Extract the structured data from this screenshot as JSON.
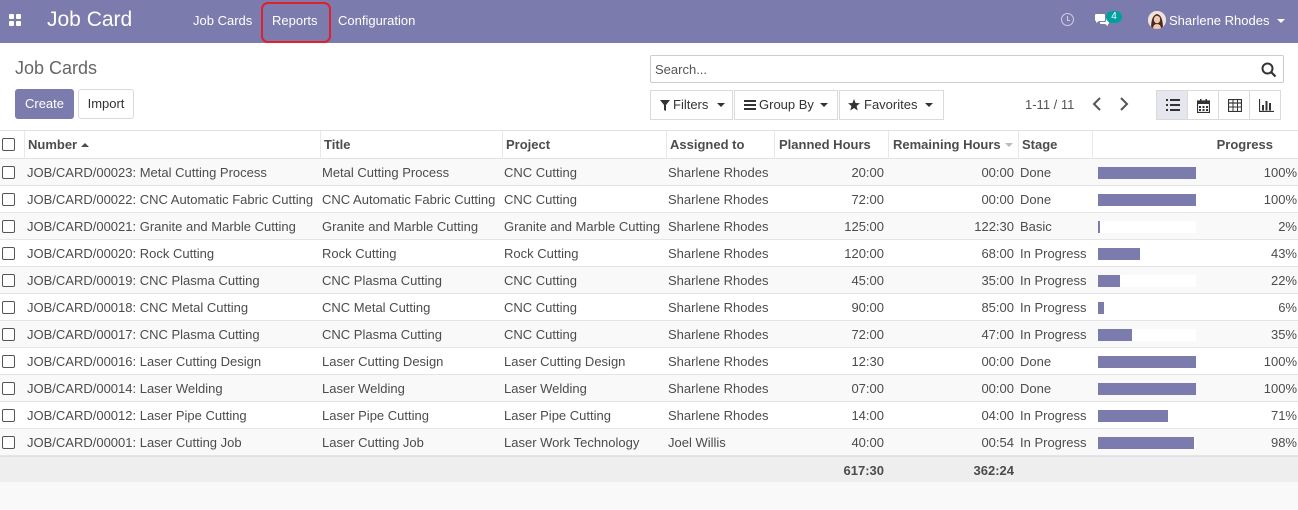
{
  "navbar": {
    "app_title": "Job Card",
    "menu": [
      "Job Cards",
      "Reports",
      "Configuration"
    ],
    "chat_badge": "4",
    "user_name": "Sharlene Rhodes",
    "icons": [
      "apps-grid-icon",
      "clock-icon",
      "chat-icon",
      "avatar",
      "caret-down-icon"
    ]
  },
  "control": {
    "breadcrumb": "Job Cards",
    "create_label": "Create",
    "import_label": "Import",
    "search_placeholder": "Search...",
    "filters_label": "Filters",
    "groupby_label": "Group By",
    "favorites_label": "Favorites",
    "pager": "1-11 / 11",
    "views": [
      "list-view-icon",
      "calendar-view-icon",
      "pivot-view-icon",
      "graph-view-icon"
    ]
  },
  "colors": {
    "brand": "#7c7bad",
    "highlight": "#e0202a",
    "badge": "#00a09d"
  },
  "table": {
    "columns": [
      "Number",
      "Title",
      "Project",
      "Assigned to",
      "Planned Hours",
      "Remaining Hours",
      "Stage",
      "Progress"
    ],
    "rows": [
      {
        "number": "JOB/CARD/00023: Metal Cutting Process",
        "title": "Metal Cutting Process",
        "project": "CNC Cutting",
        "assigned": "Sharlene Rhodes",
        "planned": "20:00",
        "remaining": "00:00",
        "stage": "Done",
        "progress": 100,
        "progress_label": "100%"
      },
      {
        "number": "JOB/CARD/00022: CNC Automatic Fabric Cutting",
        "title": "CNC Automatic Fabric Cutting",
        "project": "CNC Cutting",
        "assigned": "Sharlene Rhodes",
        "planned": "72:00",
        "remaining": "00:00",
        "stage": "Done",
        "progress": 100,
        "progress_label": "100%"
      },
      {
        "number": "JOB/CARD/00021: Granite and Marble Cutting",
        "title": "Granite and Marble Cutting",
        "project": "Granite and Marble Cutting",
        "assigned": "Sharlene Rhodes",
        "planned": "125:00",
        "remaining": "122:30",
        "stage": "Basic",
        "progress": 2,
        "progress_label": "2%"
      },
      {
        "number": "JOB/CARD/00020: Rock Cutting",
        "title": "Rock Cutting",
        "project": "Rock Cutting",
        "assigned": "Sharlene Rhodes",
        "planned": "120:00",
        "remaining": "68:00",
        "stage": "In Progress",
        "progress": 43,
        "progress_label": "43%"
      },
      {
        "number": "JOB/CARD/00019: CNC Plasma Cutting",
        "title": "CNC Plasma Cutting",
        "project": "CNC Cutting",
        "assigned": "Sharlene Rhodes",
        "planned": "45:00",
        "remaining": "35:00",
        "stage": "In Progress",
        "progress": 22,
        "progress_label": "22%"
      },
      {
        "number": "JOB/CARD/00018: CNC Metal Cutting",
        "title": "CNC Metal Cutting",
        "project": "CNC Cutting",
        "assigned": "Sharlene Rhodes",
        "planned": "90:00",
        "remaining": "85:00",
        "stage": "In Progress",
        "progress": 6,
        "progress_label": "6%"
      },
      {
        "number": "JOB/CARD/00017: CNC Plasma Cutting",
        "title": "CNC Plasma Cutting",
        "project": "CNC Cutting",
        "assigned": "Sharlene Rhodes",
        "planned": "72:00",
        "remaining": "47:00",
        "stage": "In Progress",
        "progress": 35,
        "progress_label": "35%"
      },
      {
        "number": "JOB/CARD/00016: Laser Cutting Design",
        "title": "Laser Cutting Design",
        "project": "Laser Cutting Design",
        "assigned": "Sharlene Rhodes",
        "planned": "12:30",
        "remaining": "00:00",
        "stage": "Done",
        "progress": 100,
        "progress_label": "100%"
      },
      {
        "number": "JOB/CARD/00014: Laser Welding",
        "title": "Laser Welding",
        "project": "Laser Welding",
        "assigned": "Sharlene Rhodes",
        "planned": "07:00",
        "remaining": "00:00",
        "stage": "Done",
        "progress": 100,
        "progress_label": "100%"
      },
      {
        "number": "JOB/CARD/00012: Laser Pipe Cutting",
        "title": "Laser Pipe Cutting",
        "project": "Laser Pipe Cutting",
        "assigned": "Sharlene Rhodes",
        "planned": "14:00",
        "remaining": "04:00",
        "stage": "In Progress",
        "progress": 71,
        "progress_label": "71%"
      },
      {
        "number": "JOB/CARD/00001: Laser Cutting Job",
        "title": "Laser Cutting Job",
        "project": "Laser Work Technology",
        "assigned": "Joel Willis",
        "planned": "40:00",
        "remaining": "00:54",
        "stage": "In Progress",
        "progress": 98,
        "progress_label": "98%"
      }
    ],
    "totals": {
      "planned": "617:30",
      "remaining": "362:24"
    }
  }
}
